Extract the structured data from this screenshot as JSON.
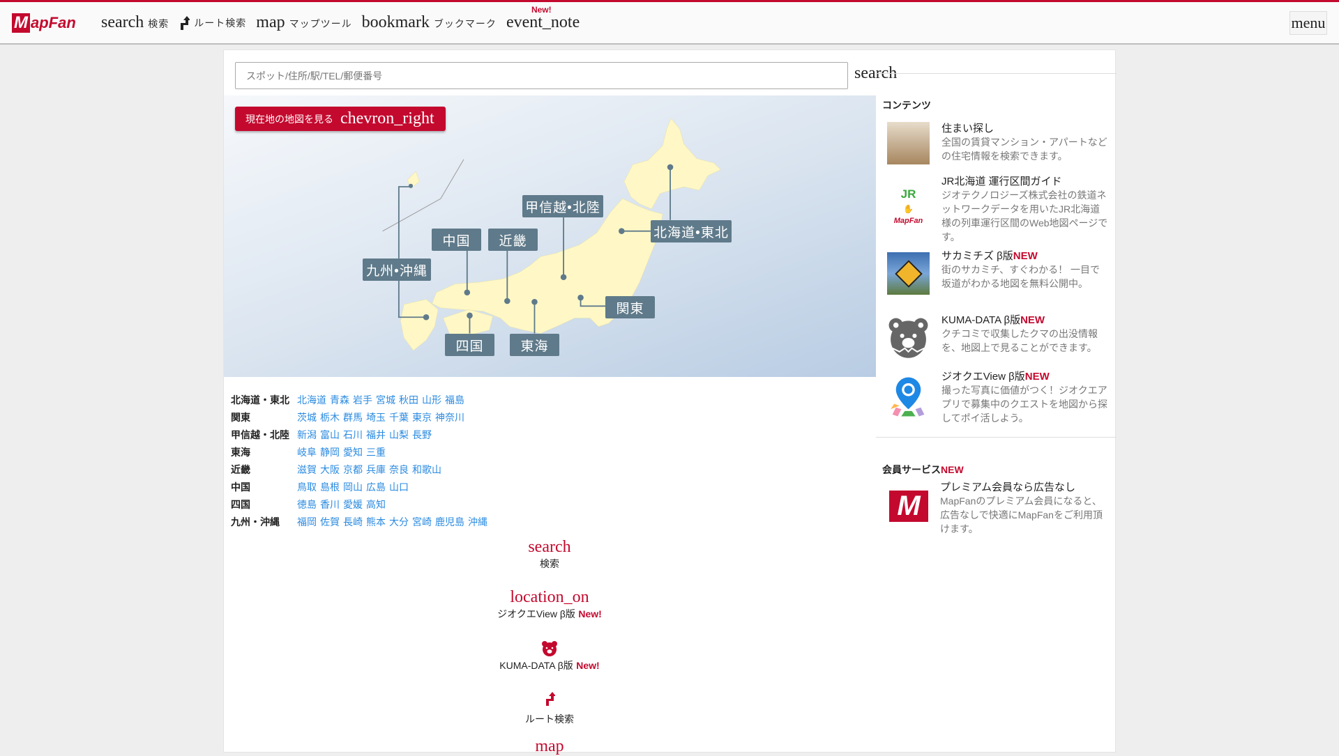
{
  "header": {
    "logo": "MapFan",
    "nav": [
      {
        "icon": "search",
        "label": "検索"
      },
      {
        "icon": "route-icon",
        "label": "ルート検索"
      },
      {
        "icon": "map",
        "label": "マップツール"
      },
      {
        "icon": "bookmark",
        "label": "ブックマーク"
      },
      {
        "icon": "event_note",
        "label": "",
        "badge": "New!"
      }
    ],
    "menu": "menu"
  },
  "search": {
    "placeholder": "スポット/住所/駅/TEL/郵便番号",
    "button": "search"
  },
  "map": {
    "current_location": {
      "label": "現在地の地図を見る",
      "icon": "chevron_right"
    },
    "regions": [
      "九州•沖縄",
      "中国",
      "近畿",
      "甲信越•北陸",
      "北海道•東北",
      "関東",
      "四国",
      "東海"
    ],
    "land_color": "#fff8c6",
    "label_color": "#5f7a8a"
  },
  "region_list": [
    {
      "name": "北海道・東北",
      "prefs": [
        "北海道",
        "青森",
        "岩手",
        "宮城",
        "秋田",
        "山形",
        "福島"
      ]
    },
    {
      "name": "関東",
      "prefs": [
        "茨城",
        "栃木",
        "群馬",
        "埼玉",
        "千葉",
        "東京",
        "神奈川"
      ]
    },
    {
      "name": "甲信越・北陸",
      "prefs": [
        "新潟",
        "富山",
        "石川",
        "福井",
        "山梨",
        "長野"
      ]
    },
    {
      "name": "東海",
      "prefs": [
        "岐阜",
        "静岡",
        "愛知",
        "三重"
      ]
    },
    {
      "name": "近畿",
      "prefs": [
        "滋賀",
        "大阪",
        "京都",
        "兵庫",
        "奈良",
        "和歌山"
      ]
    },
    {
      "name": "中国",
      "prefs": [
        "鳥取",
        "島根",
        "岡山",
        "広島",
        "山口"
      ]
    },
    {
      "name": "四国",
      "prefs": [
        "徳島",
        "香川",
        "愛媛",
        "高知"
      ]
    },
    {
      "name": "九州・沖縄",
      "prefs": [
        "福岡",
        "佐賀",
        "長崎",
        "熊本",
        "大分",
        "宮崎",
        "鹿児島",
        "沖縄"
      ]
    }
  ],
  "bottom_menu": [
    {
      "icon": "search",
      "label": "検索"
    },
    {
      "icon": "location_on",
      "label": "ジオクエView β版",
      "badge": "New!"
    },
    {
      "icon": "bear-icon",
      "label": "KUMA-DATA β版",
      "badge": "New!"
    },
    {
      "icon": "route-icon",
      "label": "ルート検索"
    },
    {
      "icon": "map",
      "label": ""
    }
  ],
  "contents": {
    "heading": "コンテンツ",
    "items": [
      {
        "title": "住まい探し",
        "badge": "",
        "desc": "全国の賃貸マンション・アパートなどの住宅情報を検索できます。"
      },
      {
        "title": "JR北海道 運行区間ガイド",
        "badge": "",
        "desc": "ジオテクノロジーズ株式会社の鉄道ネットワークデータを用いたJR北海道様の列車運行区間のWeb地図ページです。"
      },
      {
        "title": "サカミチズ β版",
        "badge": "NEW",
        "desc": "街のサカミチ、すぐわかる！ 一目で坂道がわかる地図を無料公開中。"
      },
      {
        "title": "KUMA-DATA β版",
        "badge": "NEW",
        "desc": "クチコミで収集したクマの出没情報を、地図上で見ることができます。"
      },
      {
        "title": "ジオクエView β版",
        "badge": "NEW",
        "desc": "撮った写真に価値がつく！ジオクエアプリで募集中のクエストを地図から探してポイ活しよう。"
      }
    ]
  },
  "member": {
    "heading": "会員サービス",
    "badge": "NEW",
    "item": {
      "title": "プレミアム会員なら広告なし",
      "desc": "MapFanのプレミアム会員になると、広告なしで快適にMapFanをご利用頂けます。"
    }
  },
  "brand_color": "#c4092e"
}
